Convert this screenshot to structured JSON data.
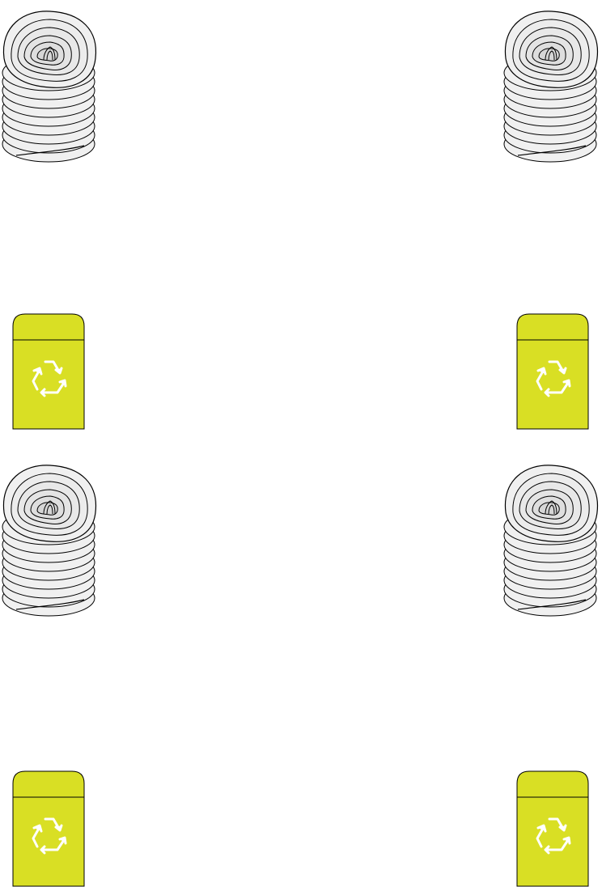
{
  "colors": {
    "bin_fill": "#d9df24",
    "bin_stroke": "#000000",
    "recycle_symbol": "#ffffff",
    "coil_fill": "#f0f0f0",
    "coil_stroke": "#000000"
  },
  "icons": {
    "coil": "spiral-coil-stack-icon",
    "bin": "recycle-bin-icon",
    "symbol": "recycle-icon"
  }
}
